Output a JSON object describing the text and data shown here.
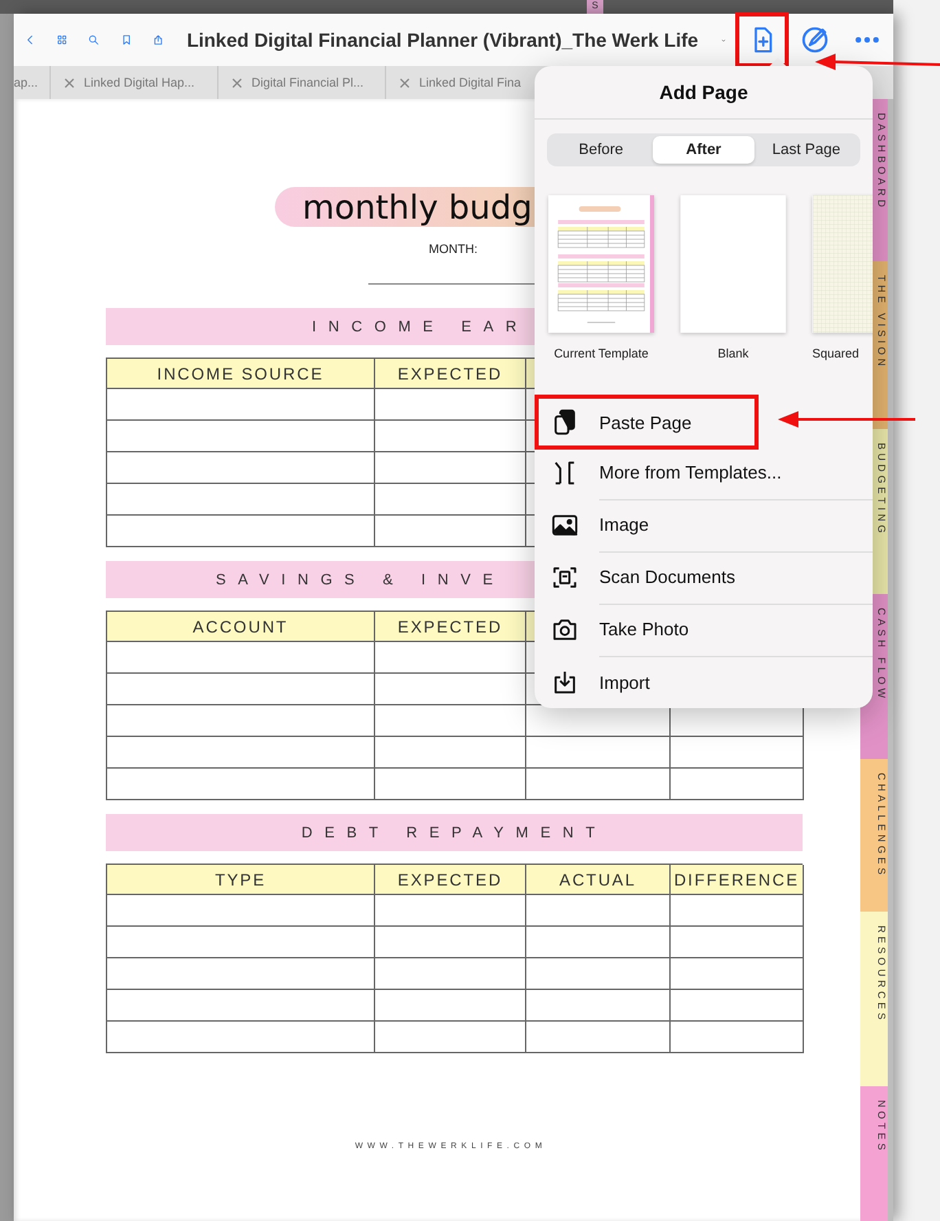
{
  "background_tab": {
    "label": "S"
  },
  "toolbar": {
    "title": "Linked Digital Financial Planner (Vibrant)_The Werk Life",
    "add_page_highlighted": true
  },
  "document_tabs": [
    {
      "label": "ap...",
      "closable": false
    },
    {
      "label": "Linked Digital Hap...",
      "closable": true
    },
    {
      "label": "Digital Financial Pl...",
      "closable": true
    },
    {
      "label": "Linked Digital Fina",
      "closable": true
    }
  ],
  "document": {
    "title": "monthly budg",
    "month_label": "MONTH:",
    "sections": [
      {
        "title": "INCOME EAR",
        "columns": [
          "INCOME SOURCE",
          "EXPECTED"
        ]
      },
      {
        "title": "SAVINGS & INVE",
        "columns": [
          "ACCOUNT",
          "EXPECTED"
        ]
      },
      {
        "title": "DEBT REPAYMENT",
        "columns": [
          "TYPE",
          "EXPECTED",
          "ACTUAL",
          "DIFFERENCE"
        ]
      }
    ],
    "footer": "WWW.THEWERKLIFE.COM"
  },
  "side_tabs": [
    {
      "label": "DASHBOARD",
      "color": "#e191c6"
    },
    {
      "label": "THE VISION",
      "color": "#e2b26e"
    },
    {
      "label": "BUDGETING",
      "color": "#e8e6a8"
    },
    {
      "label": "CASH FLOW",
      "color": "#e191c6"
    },
    {
      "label": "CHALLENGES",
      "color": "#f7c684"
    },
    {
      "label": "RESOURCES",
      "color": "#fbf5c2"
    },
    {
      "label": "NOTES",
      "color": "#f3a2d2"
    }
  ],
  "add_page_popover": {
    "title": "Add Page",
    "positions": [
      {
        "label": "Before",
        "selected": false
      },
      {
        "label": "After",
        "selected": true
      },
      {
        "label": "Last Page",
        "selected": false
      }
    ],
    "templates": [
      {
        "label": "Current Template",
        "kind": "template"
      },
      {
        "label": "Blank",
        "kind": "blank"
      },
      {
        "label": "Squared",
        "kind": "squared"
      }
    ],
    "actions": [
      {
        "label": "Paste Page",
        "highlighted": true
      },
      {
        "label": "More from Templates...",
        "highlighted": false
      },
      {
        "label": "Image",
        "highlighted": false
      },
      {
        "label": "Scan Documents",
        "highlighted": false
      },
      {
        "label": "Take Photo",
        "highlighted": false
      },
      {
        "label": "Import",
        "highlighted": false
      }
    ]
  }
}
